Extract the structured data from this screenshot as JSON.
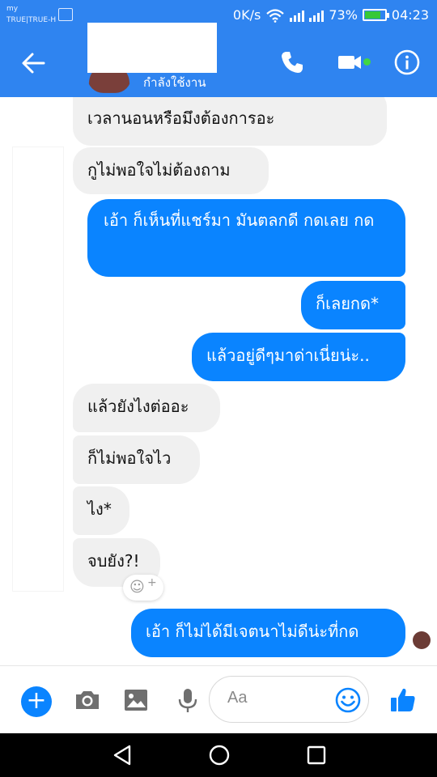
{
  "statusbar": {
    "carrier_top": "my",
    "carrier_bottom": "TRUE|TRUE-H",
    "speed": "0K/s",
    "battery": "73%",
    "time": "04:23"
  },
  "header": {
    "status": "กำลังใช้งาน",
    "online_color": "#42d642"
  },
  "messages": [
    {
      "side": "in",
      "text": "เวลานอนหรือมึงต้องการอะ"
    },
    {
      "side": "in",
      "text": "กูไม่พอใจไม่ต้องถาม"
    },
    {
      "side": "out",
      "text": "เอ้า ก็เห็นที่แชร์มา มันตลกดี กดเลย กด"
    },
    {
      "side": "out",
      "text": "ก็เลยกด*"
    },
    {
      "side": "out",
      "text": "แล้วอยู่ดีๆมาด่าเนี่ยน่ะ.."
    },
    {
      "side": "in",
      "text": "แล้วยังไงต่ออะ"
    },
    {
      "side": "in",
      "text": "ก็ไม่พอใจไว"
    },
    {
      "side": "in",
      "text": "ไง*"
    },
    {
      "side": "in",
      "text": "จบยัง?!"
    },
    {
      "side": "out",
      "text": "เอ้า ก็ไม่ได้มีเจตนาไม่ดีน่ะที่กด"
    }
  ],
  "reaction": {
    "plus": "+"
  },
  "composer": {
    "placeholder": "Aa",
    "plus": "+"
  },
  "colors": {
    "brand": "#2f84f0",
    "outgoing": "#0a84ff",
    "incoming": "#f0f0f0"
  }
}
